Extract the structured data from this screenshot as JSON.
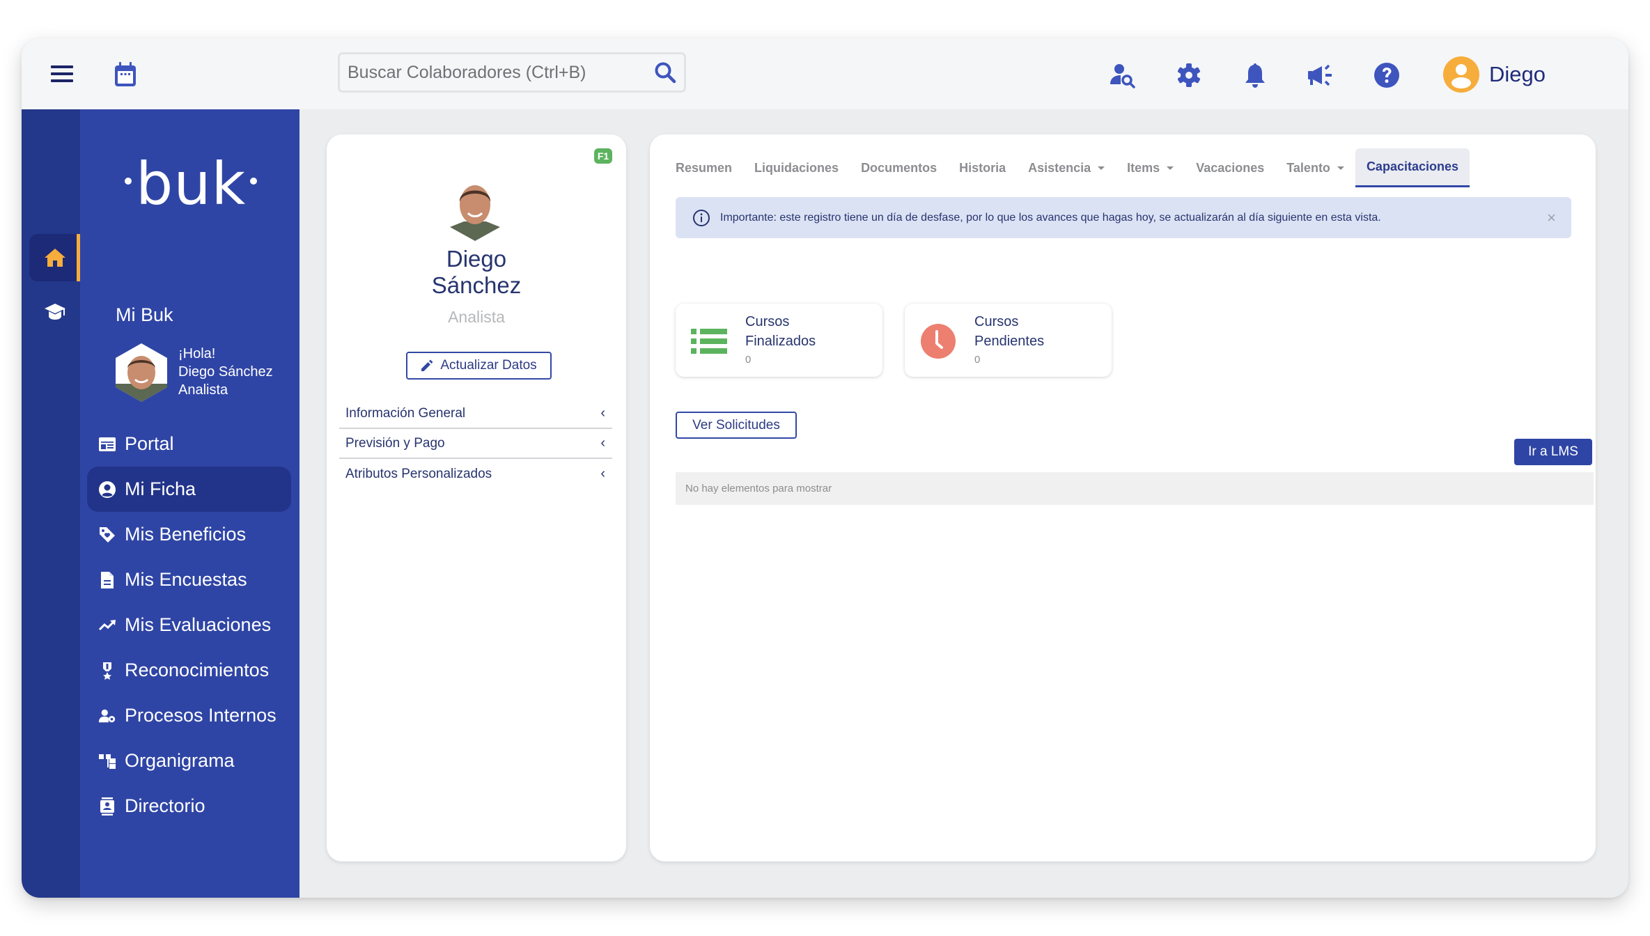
{
  "header": {
    "search_placeholder": "Buscar Colaboradores (Ctrl+B)",
    "icons": [
      "menu-icon",
      "calendar-icon",
      "search-icon",
      "user-search-icon",
      "gear-icon",
      "bell-icon",
      "megaphone-icon",
      "help-icon"
    ],
    "user_name": "Diego"
  },
  "colors": {
    "brand": "#2f45a5",
    "brand_dark": "#23388a",
    "accent": "#f6ad3c",
    "success": "#5cb35f",
    "danger": "#ec7f70"
  },
  "sidebar": {
    "logo": "buk",
    "rail": [
      {
        "icon": "home-icon",
        "active": true
      },
      {
        "icon": "graduation-cap-icon",
        "active": false
      }
    ],
    "section_title": "Mi Buk",
    "greeting": "¡Hola!",
    "user_full_name": "Diego Sánchez",
    "user_role": "Analista",
    "items": [
      {
        "label": "Portal",
        "icon": "portal-icon",
        "active": false
      },
      {
        "label": "Mi Ficha",
        "icon": "user-circle-icon",
        "active": true
      },
      {
        "label": "Mis Beneficios",
        "icon": "tag-heart-icon",
        "active": false
      },
      {
        "label": "Mis Encuestas",
        "icon": "document-icon",
        "active": false
      },
      {
        "label": "Mis Evaluaciones",
        "icon": "trend-up-icon",
        "active": false
      },
      {
        "label": "Reconocimientos",
        "icon": "medal-icon",
        "active": false
      },
      {
        "label": "Procesos Internos",
        "icon": "user-gear-icon",
        "active": false
      },
      {
        "label": "Organigrama",
        "icon": "org-chart-icon",
        "active": false
      },
      {
        "label": "Directorio",
        "icon": "contact-book-icon",
        "active": false
      }
    ]
  },
  "profile": {
    "badge": "F1",
    "first_name": "Diego",
    "last_name": "Sánchez",
    "role": "Analista",
    "update_button": "Actualizar Datos",
    "sections": [
      {
        "label": "Información General"
      },
      {
        "label": "Previsión y Pago"
      },
      {
        "label": "Atributos Personalizados"
      }
    ]
  },
  "main": {
    "tabs": [
      {
        "label": "Resumen",
        "dropdown": false,
        "active": false
      },
      {
        "label": "Liquidaciones",
        "dropdown": false,
        "active": false
      },
      {
        "label": "Documentos",
        "dropdown": false,
        "active": false
      },
      {
        "label": "Historia",
        "dropdown": false,
        "active": false
      },
      {
        "label": "Asistencia",
        "dropdown": true,
        "active": false
      },
      {
        "label": "Items",
        "dropdown": true,
        "active": false
      },
      {
        "label": "Vacaciones",
        "dropdown": false,
        "active": false
      },
      {
        "label": "Talento",
        "dropdown": true,
        "active": false
      },
      {
        "label": "Capacitaciones",
        "dropdown": false,
        "active": true
      }
    ],
    "alert": "Importante: este registro tiene un día de desfase, por lo que los avances que hagas hoy, se actualizarán al día siguiente en esta vista.",
    "alert_close": "×",
    "stats": [
      {
        "line1": "Cursos",
        "line2": "Finalizados",
        "value": "0",
        "icon": "list-icon"
      },
      {
        "line1": "Cursos",
        "line2": "Pendientes",
        "value": "0",
        "icon": "clock-icon"
      }
    ],
    "ver_solicitudes": "Ver Solicitudes",
    "ir_lms": "Ir a LMS",
    "empty_message": "No hay elementos para mostrar"
  }
}
